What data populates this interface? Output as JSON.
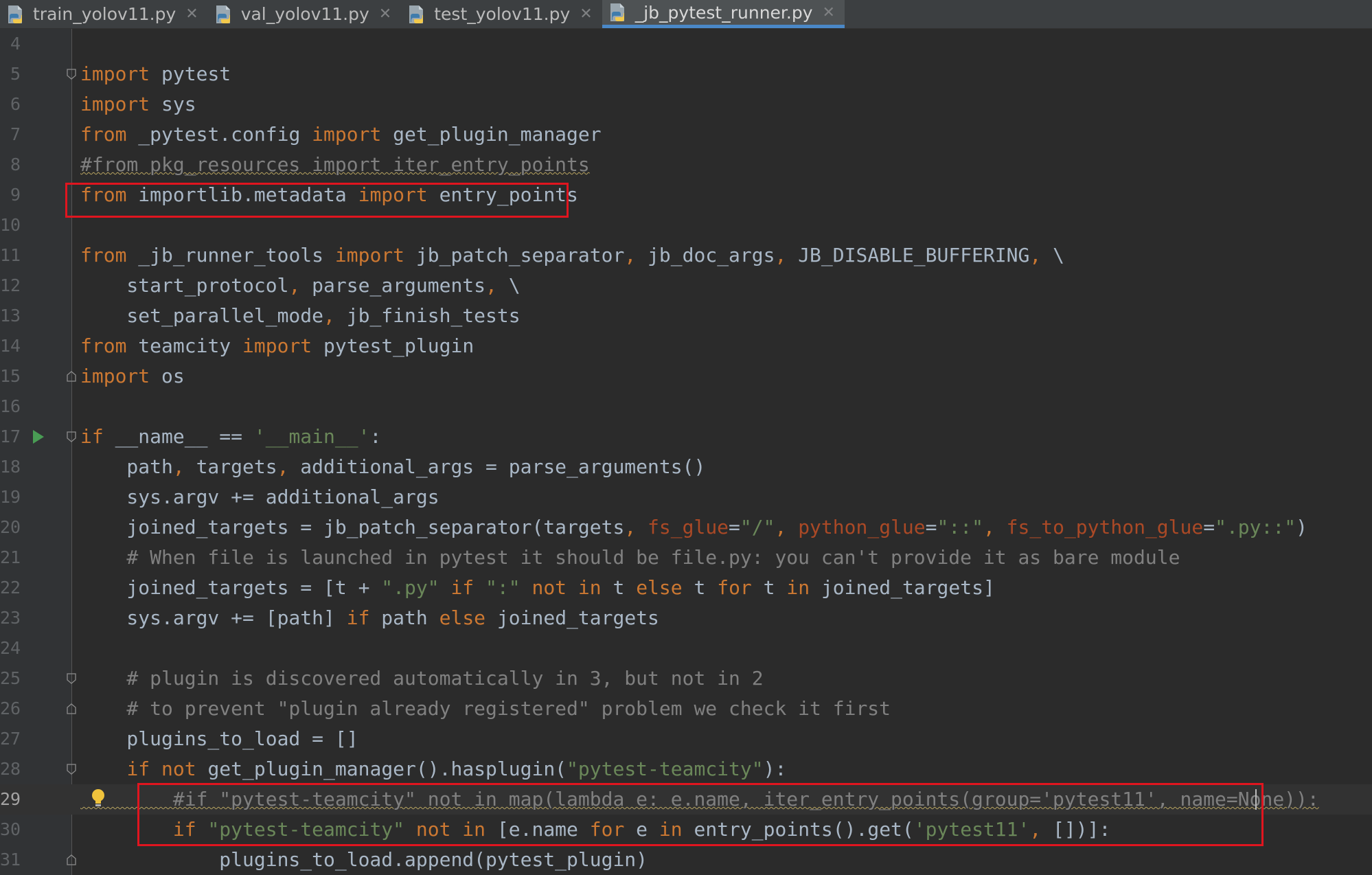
{
  "tabs": [
    {
      "label": "train_yolov11.py",
      "active": false
    },
    {
      "label": "val_yolov11.py",
      "active": false
    },
    {
      "label": "test_yolov11.py",
      "active": false
    },
    {
      "label": "_jb_pytest_runner.py",
      "active": true
    }
  ],
  "icons": {
    "tab_file": "python-file-icon",
    "tab_close": "close-icon",
    "run": "run-icon",
    "fold": "fold-marker-icon",
    "intention": "lightbulb-icon"
  },
  "colors": {
    "keyword": "#cc7832",
    "string": "#6a8759",
    "comment": "#808080",
    "param": "#aa4926",
    "text": "#a9b7c6",
    "highlight_box": "#e0151f",
    "active_tab_underline": "#4a88c7"
  },
  "editor": {
    "current_line": "29",
    "lines": [
      {
        "n": "4",
        "segs": []
      },
      {
        "n": "5",
        "segs": [
          [
            "kw",
            "import"
          ],
          [
            "t",
            " pytest"
          ]
        ]
      },
      {
        "n": "6",
        "segs": [
          [
            "kw",
            "import"
          ],
          [
            "t",
            " sys"
          ]
        ]
      },
      {
        "n": "7",
        "segs": [
          [
            "kw",
            "from"
          ],
          [
            "t",
            " _pytest.config "
          ],
          [
            "kw",
            "import"
          ],
          [
            "t",
            " get_plugin_manager"
          ]
        ]
      },
      {
        "n": "8",
        "segs": [
          [
            "dep",
            "#from pkg_resources import iter_entry_points"
          ]
        ]
      },
      {
        "n": "9",
        "segs": [
          [
            "kw",
            "from"
          ],
          [
            "t",
            " importlib.metadata "
          ],
          [
            "kw",
            "import"
          ],
          [
            "t",
            " entry_points"
          ]
        ]
      },
      {
        "n": "10",
        "segs": []
      },
      {
        "n": "11",
        "segs": [
          [
            "kw",
            "from"
          ],
          [
            "t",
            " _jb_runner_tools "
          ],
          [
            "kw",
            "import"
          ],
          [
            "t",
            " jb_patch_separator"
          ],
          [
            "kw",
            ","
          ],
          [
            "t",
            " jb_doc_args"
          ],
          [
            "kw",
            ","
          ],
          [
            "t",
            " JB_DISABLE_BUFFERING"
          ],
          [
            "kw",
            ","
          ],
          [
            "t",
            " \\"
          ]
        ]
      },
      {
        "n": "12",
        "segs": [
          [
            "t",
            "    start_protocol"
          ],
          [
            "kw",
            ","
          ],
          [
            "t",
            " parse_arguments"
          ],
          [
            "kw",
            ","
          ],
          [
            "t",
            " \\"
          ]
        ]
      },
      {
        "n": "13",
        "segs": [
          [
            "t",
            "    set_parallel_mode"
          ],
          [
            "kw",
            ","
          ],
          [
            "t",
            " jb_finish_tests"
          ]
        ]
      },
      {
        "n": "14",
        "segs": [
          [
            "kw",
            "from"
          ],
          [
            "t",
            " teamcity "
          ],
          [
            "kw",
            "import"
          ],
          [
            "t",
            " pytest_plugin"
          ]
        ]
      },
      {
        "n": "15",
        "segs": [
          [
            "kw",
            "import"
          ],
          [
            "t",
            " os"
          ]
        ]
      },
      {
        "n": "16",
        "segs": []
      },
      {
        "n": "17",
        "segs": [
          [
            "kw",
            "if"
          ],
          [
            "t",
            " __name__ == "
          ],
          [
            "str",
            "'__main__'"
          ],
          [
            "t",
            ":"
          ]
        ]
      },
      {
        "n": "18",
        "segs": [
          [
            "t",
            "    path"
          ],
          [
            "kw",
            ","
          ],
          [
            "t",
            " targets"
          ],
          [
            "kw",
            ","
          ],
          [
            "t",
            " additional_args = parse_arguments()"
          ]
        ]
      },
      {
        "n": "19",
        "segs": [
          [
            "t",
            "    sys.argv += additional_args"
          ]
        ]
      },
      {
        "n": "20",
        "segs": [
          [
            "t",
            "    joined_targets = jb_patch_separator(targets"
          ],
          [
            "kw",
            ","
          ],
          [
            "t",
            " "
          ],
          [
            "param",
            "fs_glue"
          ],
          [
            "t",
            "="
          ],
          [
            "str",
            "\"/\""
          ],
          [
            "kw",
            ","
          ],
          [
            "t",
            " "
          ],
          [
            "param",
            "python_glue"
          ],
          [
            "t",
            "="
          ],
          [
            "str",
            "\"::\""
          ],
          [
            "kw",
            ","
          ],
          [
            "t",
            " "
          ],
          [
            "param",
            "fs_to_python_glue"
          ],
          [
            "t",
            "="
          ],
          [
            "str",
            "\".py::\""
          ],
          [
            "t",
            ")"
          ]
        ]
      },
      {
        "n": "21",
        "segs": [
          [
            "cmt",
            "    # When file is launched in pytest it should be file.py: you can't provide it as bare module"
          ]
        ]
      },
      {
        "n": "22",
        "segs": [
          [
            "t",
            "    joined_targets = [t + "
          ],
          [
            "str",
            "\".py\""
          ],
          [
            "t",
            " "
          ],
          [
            "kw",
            "if"
          ],
          [
            "t",
            " "
          ],
          [
            "str",
            "\":\""
          ],
          [
            "t",
            " "
          ],
          [
            "kw",
            "not in"
          ],
          [
            "t",
            " t "
          ],
          [
            "kw",
            "else"
          ],
          [
            "t",
            " t "
          ],
          [
            "kw",
            "for"
          ],
          [
            "t",
            " t "
          ],
          [
            "kw",
            "in"
          ],
          [
            "t",
            " joined_targets]"
          ]
        ]
      },
      {
        "n": "23",
        "segs": [
          [
            "t",
            "    sys.argv += [path] "
          ],
          [
            "kw",
            "if"
          ],
          [
            "t",
            " path "
          ],
          [
            "kw",
            "else"
          ],
          [
            "t",
            " joined_targets"
          ]
        ]
      },
      {
        "n": "24",
        "segs": []
      },
      {
        "n": "25",
        "segs": [
          [
            "cmt",
            "    # plugin is discovered automatically in 3, but not in 2"
          ]
        ]
      },
      {
        "n": "26",
        "segs": [
          [
            "cmt",
            "    # to prevent \"plugin already registered\" problem we check it first"
          ]
        ]
      },
      {
        "n": "27",
        "segs": [
          [
            "t",
            "    plugins_to_load = []"
          ]
        ]
      },
      {
        "n": "28",
        "segs": [
          [
            "t",
            "    "
          ],
          [
            "kw",
            "if not"
          ],
          [
            "t",
            " get_plugin_manager().hasplugin("
          ],
          [
            "str",
            "\"pytest-teamcity\""
          ],
          [
            "t",
            "):"
          ]
        ]
      },
      {
        "n": "29",
        "segs": [
          [
            "dep",
            "        #if \"pytest-teamcity\" not in map(lambda e: e.name, iter_entry_points(group='pytest11', name=None)):"
          ]
        ]
      },
      {
        "n": "30",
        "segs": [
          [
            "t",
            "        "
          ],
          [
            "kw",
            "if"
          ],
          [
            "t",
            " "
          ],
          [
            "str",
            "\"pytest-teamcity\""
          ],
          [
            "t",
            " "
          ],
          [
            "kw",
            "not in"
          ],
          [
            "t",
            " [e.name "
          ],
          [
            "kw",
            "for"
          ],
          [
            "t",
            " e "
          ],
          [
            "kw",
            "in"
          ],
          [
            "t",
            " entry_points().get("
          ],
          [
            "str",
            "'pytest11'"
          ],
          [
            "kw",
            ","
          ],
          [
            "t",
            " [])]:"
          ]
        ]
      },
      {
        "n": "31",
        "segs": [
          [
            "t",
            "            plugins_to_load.append(pytest_plugin)"
          ]
        ]
      }
    ]
  }
}
